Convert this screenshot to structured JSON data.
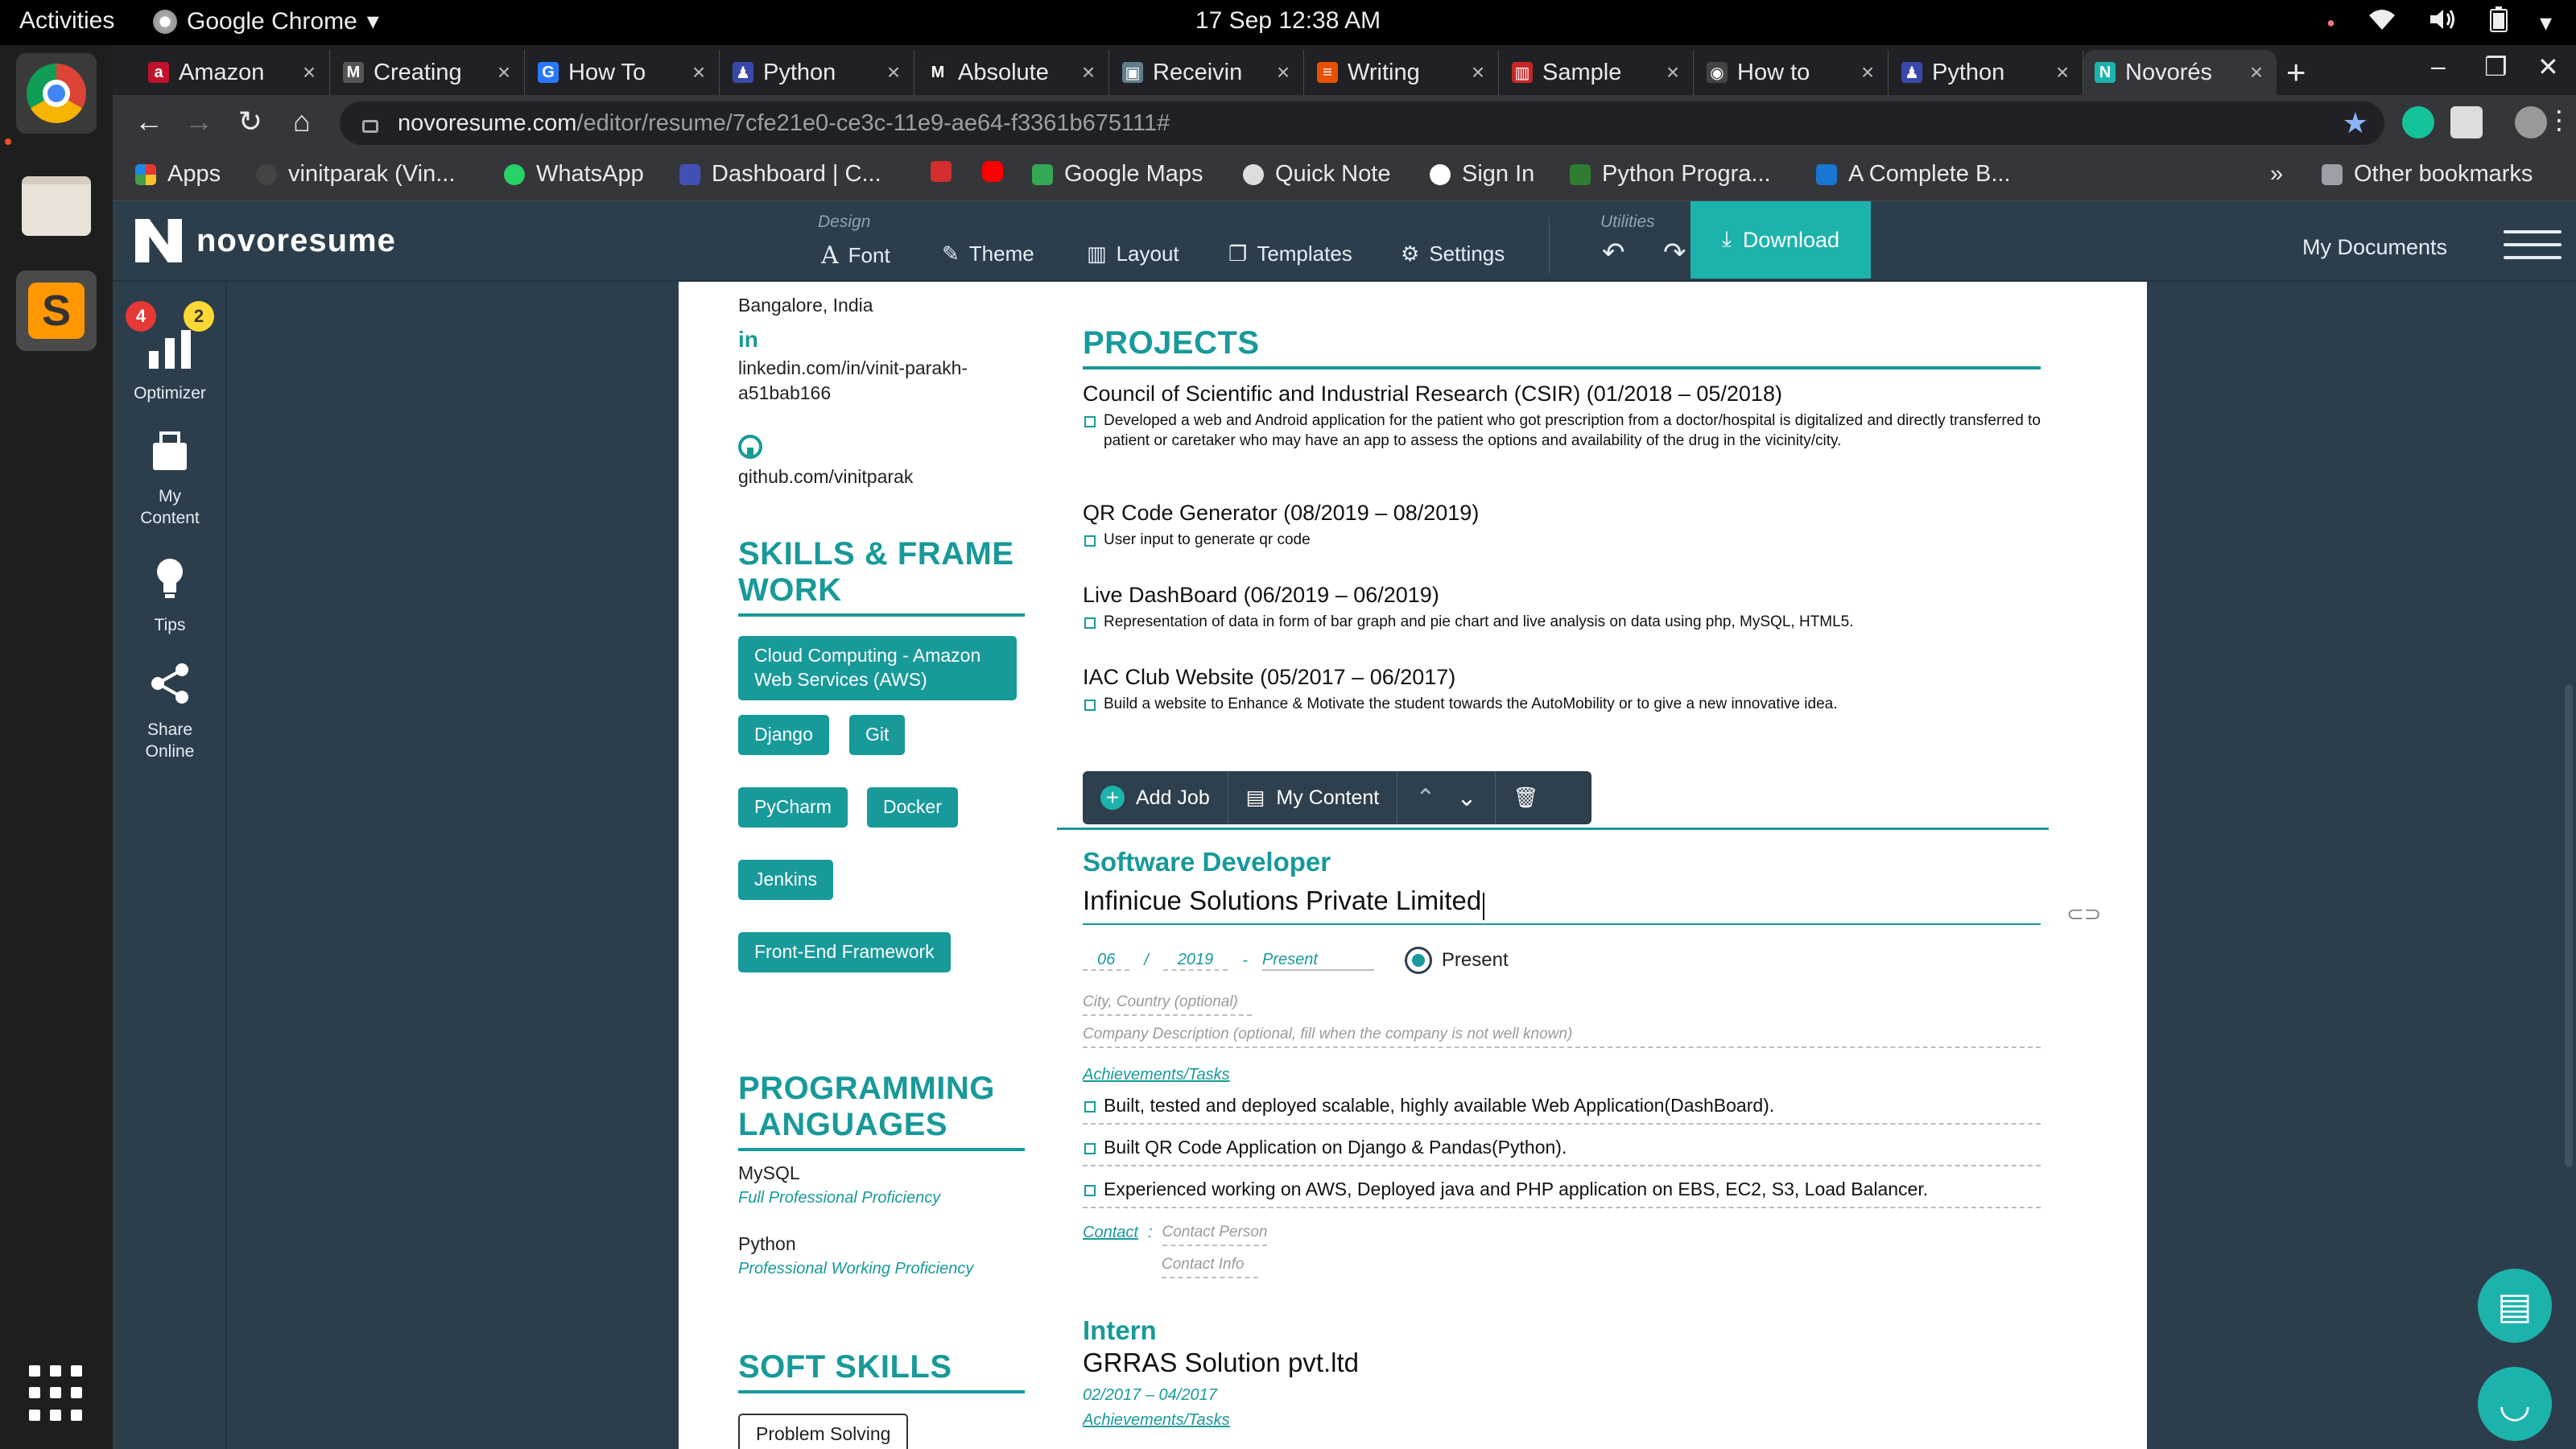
{
  "system": {
    "activities": "Activities",
    "app_name": "Google Chrome",
    "clock": "17 Sep  12:38 AM"
  },
  "tabs": [
    {
      "title": "Amazon",
      "color": "#c0122b",
      "glyph": "a"
    },
    {
      "title": "Creating",
      "color": "#555555",
      "glyph": "M"
    },
    {
      "title": "How To",
      "color": "#2979ff",
      "glyph": "G"
    },
    {
      "title": "Python",
      "color": "#3949ab",
      "glyph": "♟"
    },
    {
      "title": "Absolute",
      "color": "#222222",
      "glyph": "M"
    },
    {
      "title": "Receivin",
      "color": "#607d8b",
      "glyph": "▣"
    },
    {
      "title": "Writing",
      "color": "#e65100",
      "glyph": "≡"
    },
    {
      "title": "Sample",
      "color": "#c62828",
      "glyph": "▥"
    },
    {
      "title": "How to",
      "color": "#444444",
      "glyph": "◉"
    },
    {
      "title": "Python",
      "color": "#3949ab",
      "glyph": "♟"
    },
    {
      "title": "Novorés",
      "color": "#1db3ad",
      "glyph": "N"
    }
  ],
  "url": {
    "domain": "novoresume.com",
    "path": "/editor/resume/7cfe21e0-ce3c-11e9-ae64-f3361b675111#"
  },
  "bookmarks": [
    {
      "label": "Apps",
      "color": "#e53935"
    },
    {
      "label": "vinitparak (Vin...",
      "color": "#444444"
    },
    {
      "label": "WhatsApp",
      "color": "#25d366"
    },
    {
      "label": "Dashboard | C...",
      "color": "#3f51b5"
    },
    {
      "label": "",
      "color": "#d32f2f"
    },
    {
      "label": "",
      "color": "#ff0000"
    },
    {
      "label": "Google Maps",
      "color": "#34a853"
    },
    {
      "label": "Quick Note",
      "color": "#dddddd"
    },
    {
      "label": "Sign In",
      "color": "#ffffff"
    },
    {
      "label": "Python Progra...",
      "color": "#2e7d32"
    },
    {
      "label": "A Complete B...",
      "color": "#1976d2"
    }
  ],
  "bookmarks_more": "»",
  "other_bookmarks": "Other bookmarks",
  "app": {
    "brand": "novoresume",
    "design_label": "Design",
    "utilities_label": "Utilities",
    "menu": {
      "font": "Font",
      "theme": "Theme",
      "layout": "Layout",
      "templates": "Templates",
      "settings": "Settings"
    },
    "download": "Download",
    "my_documents": "My Documents",
    "sidebar": {
      "optimizer": "Optimizer",
      "optimizer_badge_red": "4",
      "optimizer_badge_yellow": "2",
      "my_content": "My Content",
      "tips": "Tips",
      "share": "Share Online"
    }
  },
  "resume": {
    "location": "Bangalore, India",
    "linkedin": "linkedin.com/in/vinit-parakh-a51bab166",
    "github": "github.com/vinitparak",
    "skills_heading": "SKILLS & FRAME WORK",
    "skills": [
      "Cloud Computing - Amazon Web Services (AWS)",
      "Django",
      "Git",
      "PyCharm",
      "Docker",
      "Jenkins",
      "Front-End Framework"
    ],
    "languages_heading": "PROGRAMMING LANGUAGES",
    "languages": [
      {
        "name": "MySQL",
        "level": "Full Professional Proficiency"
      },
      {
        "name": "Python",
        "level": "Professional Working Proficiency"
      }
    ],
    "soft_heading": "SOFT SKILLS",
    "soft_skills": [
      "Problem Solving"
    ],
    "projects_heading": "PROJECTS",
    "projects": [
      {
        "title": "Council of Scientific and Industrial Research (CSIR) (01/2018 – 05/2018)",
        "desc": "Developed a web and Android application for the patient who got prescription from a doctor/hospital is digitalized and directly transferred to patient or caretaker who may have an app to assess the options and availability of the drug in the vicinity/city."
      },
      {
        "title": "QR Code Generator (08/2019 – 08/2019)",
        "desc": "User input to generate qr code"
      },
      {
        "title": "Live DashBoard (06/2019 – 06/2019)",
        "desc": "Representation of data in form of bar graph and pie chart and live analysis on data using php, MySQL, HTML5."
      },
      {
        "title": "IAC Club Website (05/2017 – 06/2017)",
        "desc": "Build a website to Enhance & Motivate the student towards the AutoMobility or to give a new innovative idea."
      }
    ],
    "job_toolbar": {
      "add_job": "Add Job",
      "my_content": "My Content"
    },
    "job": {
      "title": "Software Developer",
      "company": "Infinicue Solutions Private Limited",
      "month": "06",
      "slash": "/",
      "year": "2019",
      "to_dash": "-",
      "end": "Present",
      "present_label": "Present",
      "city_placeholder": "City, Country (optional)",
      "company_desc_placeholder": "Company Description (optional, fill when the company is not well known)",
      "achievements_label": "Achievements/Tasks",
      "tasks": [
        "Built, tested and deployed scalable, highly available Web Application(DashBoard).",
        "Built QR Code Application on Django & Pandas(Python).",
        "Experienced working on AWS, Deployed java and PHP application on EBS, EC2, S3, Load Balancer."
      ],
      "contact_label": "Contact",
      "contact_colon": ":",
      "contact_person": "Contact Person",
      "contact_info": "Contact Info"
    },
    "job2": {
      "title": "Intern",
      "company": "GRRAS Solution pvt.ltd",
      "dates": "02/2017 – 04/2017",
      "achievements_label": "Achievements/Tasks"
    }
  }
}
